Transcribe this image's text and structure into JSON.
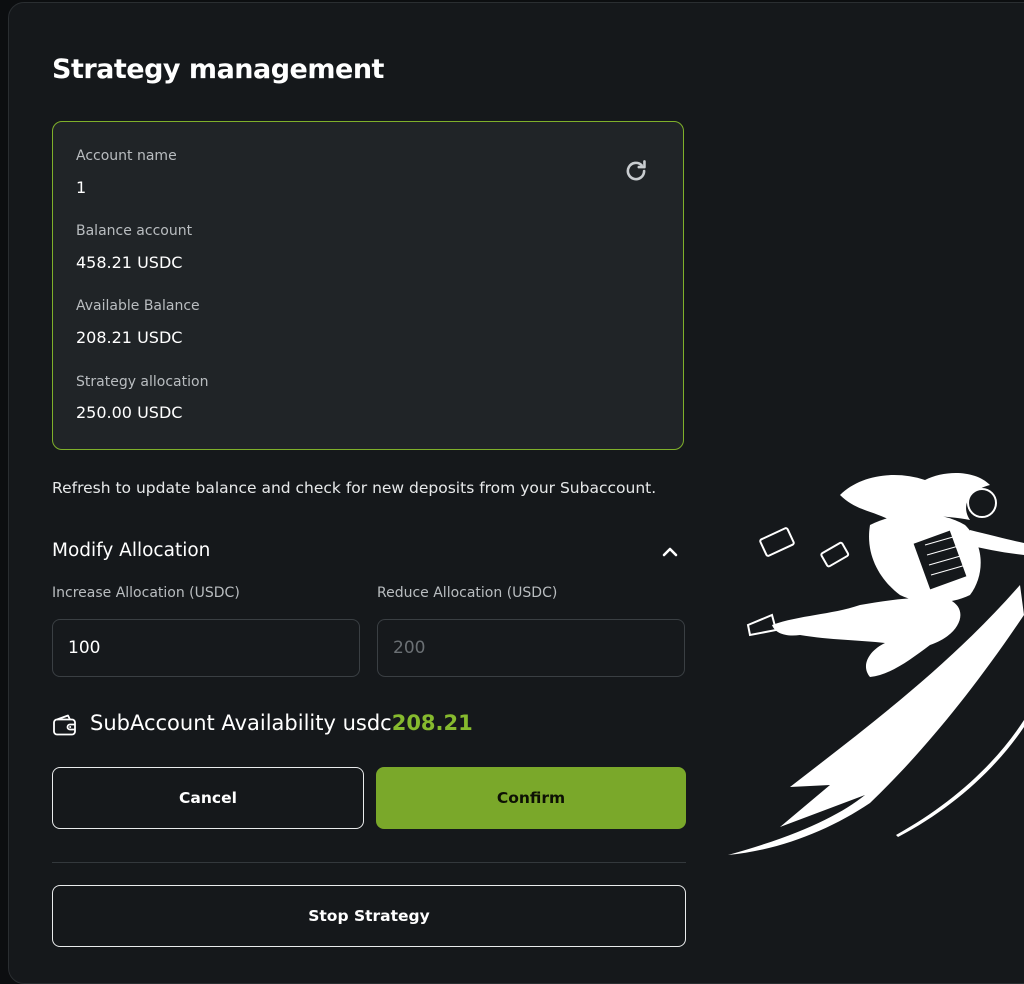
{
  "page": {
    "title": "Strategy management"
  },
  "account": {
    "name_label": "Account name",
    "name_value": "1",
    "balance_label": "Balance account",
    "balance_value": "458.21 USDC",
    "available_label": "Available Balance",
    "available_value": "208.21 USDC",
    "allocation_label": "Strategy allocation",
    "allocation_value": "250.00 USDC",
    "refresh_icon": "refresh-icon"
  },
  "hint": "Refresh to update balance and check for new deposits from your Subaccount.",
  "modify": {
    "title": "Modify Allocation",
    "toggle_icon": "chevron-up-icon",
    "increase_label": "Increase Allocation (USDC)",
    "increase_value": "100",
    "reduce_label": "Reduce Allocation (USDC)",
    "reduce_placeholder": "200"
  },
  "availability": {
    "icon": "wallet-icon",
    "label": "SubAccount Availability usdc",
    "amount": "208.21"
  },
  "actions": {
    "cancel": "Cancel",
    "confirm": "Confirm",
    "stop": "Stop Strategy"
  },
  "colors": {
    "accent": "#7aa82a",
    "accent_text": "#86ba2e",
    "card_border": "#7fb02a",
    "panel_bg": "#15181b",
    "card_bg": "#202427"
  }
}
